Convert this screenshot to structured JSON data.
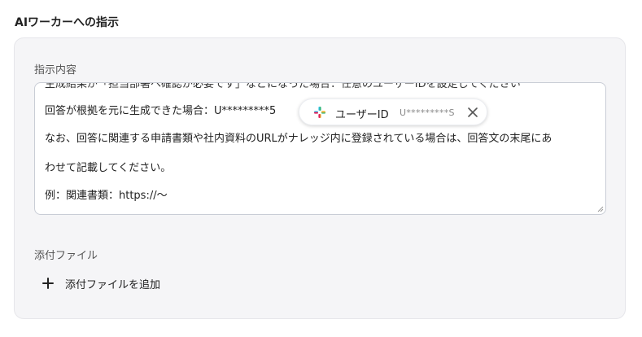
{
  "section": {
    "title": "AIワーカーへの指示"
  },
  "instructions": {
    "label": "指示内容",
    "lines": [
      "生成結果が「担当部署へ確認が必要です」などになった場合：任意のユーザーIDを設定してください",
      "回答が根拠を元に生成できた場合：U*********5",
      "なお、回答に関連する申請書類や社内資料のURLがナレッジ内に登録されている場合は、回答文の末尾にあ",
      "わせて記載してください。",
      "例：関連書類：https://～"
    ],
    "chip": {
      "icon": "slack-icon",
      "label": "ユーザーID",
      "value": "U*********S",
      "close_icon": "close-icon"
    }
  },
  "attachments": {
    "label": "添付ファイル",
    "add_label": "添付ファイルを追加",
    "add_icon": "plus-icon"
  },
  "colors": {
    "card_bg": "#f5f5f7",
    "border": "#c9cdd6",
    "slack_blue": "#36C5F0",
    "slack_green": "#2EB67D",
    "slack_yellow": "#ECB22E",
    "slack_red": "#E01E5A"
  }
}
